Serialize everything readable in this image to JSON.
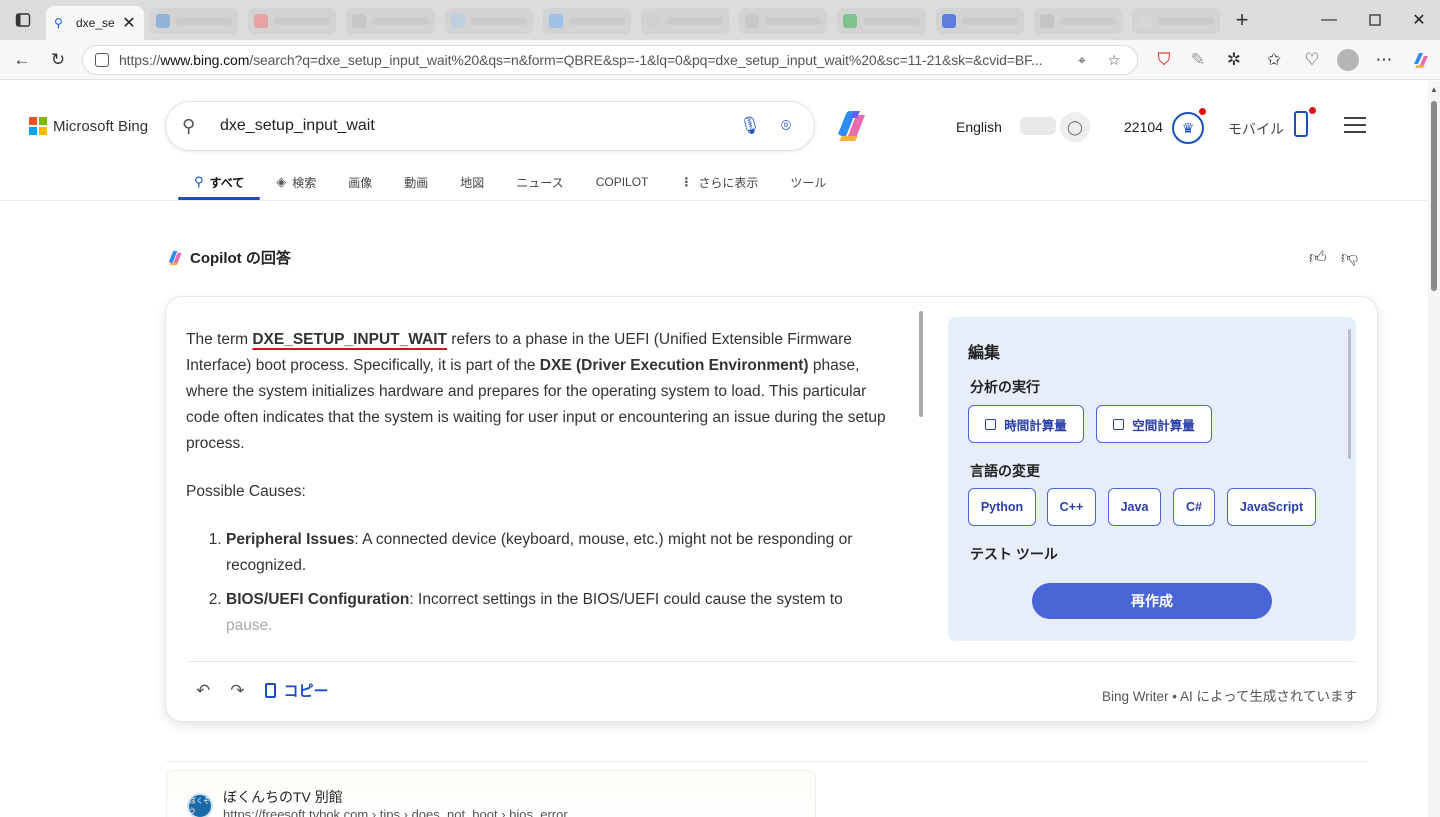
{
  "browser": {
    "tab_title": "dxe_se",
    "url_prefix": "https://",
    "url_host": "www.bing.com",
    "url_rest": "/search?q=dxe_setup_input_wait%20&qs=n&form=QBRE&sp=-1&lq=0&pq=dxe_setup_input_wait%20&sc=11-21&sk=&cvid=BF...",
    "background_tabs": [
      "#8fb3d9",
      "#e9a0a0",
      "#c7c7c7",
      "#bfcfe0",
      "#9fc0e8",
      "#d0d0d0",
      "#c9c9c9",
      "#7ec28e",
      "#5b7fe0",
      "#c4c4c4",
      "#d6d6d6"
    ]
  },
  "bing": {
    "logo_text": "Microsoft Bing",
    "search_query": "dxe_setup_input_wait",
    "language": "English",
    "points": "22104",
    "mobile_label": "モバイル",
    "nav_tabs": [
      {
        "label": "すべて",
        "icon": "search-icon"
      },
      {
        "label": "検索",
        "icon": "copilot-search-icon"
      },
      {
        "label": "画像"
      },
      {
        "label": "動画"
      },
      {
        "label": "地図"
      },
      {
        "label": "ニュース"
      },
      {
        "label": "COPILOT"
      },
      {
        "label": "さらに表示"
      },
      {
        "label": "ツール"
      }
    ]
  },
  "copilot": {
    "header": "Copilot の回答",
    "answer": {
      "p1_before": "The term ",
      "p1_key": "DXE_SETUP_INPUT_WAIT",
      "p1_mid": " refers to a phase in the UEFI (Unified Extensible Firmware Interface) boot process. Specifically, it is part of the ",
      "p1_bold": "DXE (Driver Execution Environment)",
      "p1_after": " phase, where the system initializes hardware and prepares for the operating system to load. This particular code often indicates that the system is waiting for user input or encountering an issue during the setup process.",
      "p2": "Possible Causes:",
      "items": [
        {
          "bold": "Peripheral Issues",
          "text": ": A connected device (keyboard, mouse, etc.) might not be responding or recognized."
        },
        {
          "bold": "BIOS/UEFI Configuration",
          "text": ": Incorrect settings in the BIOS/UEFI could cause the system to",
          "fade": "pause."
        }
      ]
    },
    "panel": {
      "title": "編集",
      "sec_analysis": "分析の実行",
      "chip_time": "時間計算量",
      "chip_space": "空間計算量",
      "sec_language": "言語の変更",
      "languages": [
        "Python",
        "C++",
        "Java",
        "C#",
        "JavaScript"
      ],
      "sec_test": "テスト ツール",
      "regenerate": "再作成"
    },
    "copy_label": "コピー",
    "footnote": "Bing Writer • AI によって生成されています"
  },
  "result": {
    "site_name": "ぼくんちのTV 別館",
    "favicon_text": "ぼくそう",
    "breadcrumb": "https://freesoft.tvbok.com › tips › does_not_boot › bios_error"
  },
  "colors": {
    "accent": "#1a4fbf",
    "panel_bg": "#e8eef9",
    "chip_border": "#4a66d6",
    "underline_red": "#d0141e"
  }
}
